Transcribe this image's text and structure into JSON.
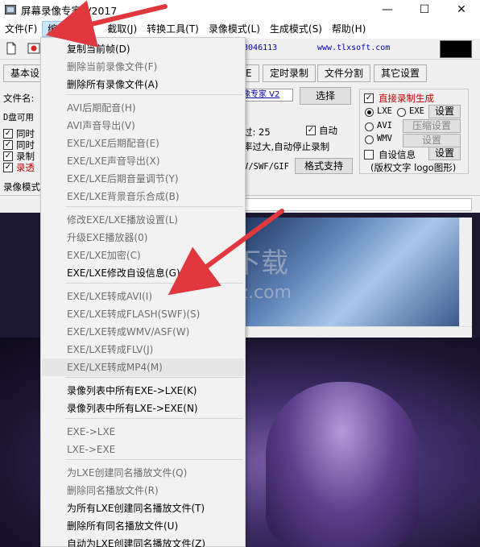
{
  "window": {
    "title": "屏幕录像专家 V2017",
    "minimize": "—",
    "maximize": "☐",
    "close": "✕"
  },
  "menubar": [
    {
      "label": "文件(F)"
    },
    {
      "label": "编辑(E)"
    },
    {
      "label": "截取(J)"
    },
    {
      "label": "转换工具(T)"
    },
    {
      "label": "录像模式(L)"
    },
    {
      "label": "生成模式(S)"
    },
    {
      "label": "帮助(H)"
    }
  ],
  "toolbar": {
    "registration": "78046113",
    "website": "www.tlxsoft.com"
  },
  "panel": {
    "tabs": [
      "基本设",
      "E",
      "定时录制",
      "文件分割",
      "其它设置"
    ],
    "filename_label": "文件名:",
    "filename_value": "像专家 V2",
    "choose_button": "选择",
    "disk_label": "D盘可用",
    "left_checks": [
      {
        "label": "同时",
        "checked": true
      },
      {
        "label": "同时",
        "checked": true
      },
      {
        "label": "录制",
        "checked": true
      },
      {
        "label": "录透",
        "checked": true,
        "red": true
      }
    ],
    "exceed_label": "过: 25",
    "auto_label": "自动",
    "auto_checked": true,
    "auto_stop_label": "率过大,自动停止录制",
    "format_label": "V/SWF/GIF",
    "format_support_button": "格式支持",
    "mode_label": "录像模式",
    "direct_gen_label": "直接录制生成",
    "direct_gen_checked": true,
    "formats": [
      {
        "label": "LXE",
        "selected": true
      },
      {
        "label": "EXE",
        "selected": false
      },
      {
        "label": "AVI",
        "selected": false
      },
      {
        "label": "WMV",
        "selected": false
      }
    ],
    "settings_button": "设置",
    "compress_button": "压缩设置",
    "wmv_settings_button": "设置",
    "custom_info_label": "自设信息",
    "custom_info_checked": false,
    "custom_info_button": "设置",
    "copyright_label": "(版权文字 logo图形)"
  },
  "watermark": {
    "text_cn": "安下载",
    "text_en": "anxz.com"
  },
  "dropdown": {
    "items": [
      {
        "label": "复制当前帧(D)",
        "disabled": false
      },
      {
        "label": "删除当前录像文件(F)",
        "disabled": true
      },
      {
        "label": "删除所有录像文件(A)",
        "disabled": false
      },
      {
        "label": "AVI后期配音(H)",
        "disabled": true
      },
      {
        "label": "AVI声音导出(V)",
        "disabled": true
      },
      {
        "label": "EXE/LXE后期配音(E)",
        "disabled": true
      },
      {
        "label": "EXE/LXE声音导出(X)",
        "disabled": true
      },
      {
        "label": "EXE/LXE后期音量调节(Y)",
        "disabled": true
      },
      {
        "label": "EXE/LXE背景音乐合成(B)",
        "disabled": true
      },
      {
        "label": "修改EXE/LXE播放设置(L)",
        "disabled": true
      },
      {
        "label": "升级EXE播放器(0)",
        "disabled": true
      },
      {
        "label": "EXE/LXE加密(C)",
        "disabled": true
      },
      {
        "label": "EXE/LXE修改自设信息(G)",
        "disabled": false
      },
      {
        "label": "EXE/LXE转成AVI(I)",
        "disabled": true
      },
      {
        "label": "EXE/LXE转成FLASH(SWF)(S)",
        "disabled": true
      },
      {
        "label": "EXE/LXE转成WMV/ASF(W)",
        "disabled": true
      },
      {
        "label": "EXE/LXE转成FLV(J)",
        "disabled": true
      },
      {
        "label": "EXE/LXE转成MP4(M)",
        "disabled": true
      },
      {
        "label": "录像列表中所有EXE->LXE(K)",
        "disabled": false
      },
      {
        "label": "录像列表中所有LXE->EXE(N)",
        "disabled": false
      },
      {
        "label": "EXE->LXE",
        "disabled": true
      },
      {
        "label": "LXE->EXE",
        "disabled": true
      },
      {
        "label": "为LXE创建同名播放文件(Q)",
        "disabled": true
      },
      {
        "label": "删除同名播放文件(R)",
        "disabled": true
      },
      {
        "label": "为所有LXE创建同名播放文件(T)",
        "disabled": false
      },
      {
        "label": "删除所有同名播放文件(U)",
        "disabled": false
      },
      {
        "label": "自动为LXE创建同名播放文件(Z)",
        "disabled": false
      }
    ]
  },
  "colors": {
    "arrow": "#e0383e",
    "menu_highlight": "#cce4f7",
    "link_blue": "#0000aa",
    "warn_red": "#c00000"
  }
}
